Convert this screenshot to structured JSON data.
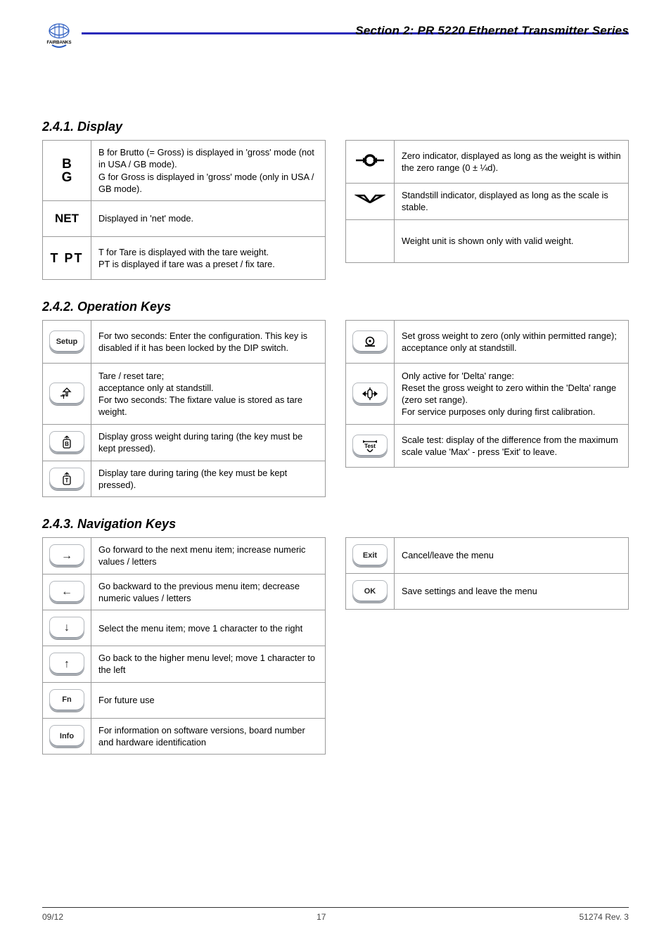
{
  "header": {
    "section_title": "Section 2: PR 5220 Ethernet Transmitter Series"
  },
  "section1": {
    "title": "2.4.1. Display",
    "left": [
      {
        "symbol": "B\nG",
        "desc": "B for Brutto (= Gross) is displayed in 'gross' mode (not in USA / GB mode).\nG for Gross is displayed in 'gross' mode (only in USA / GB mode)."
      },
      {
        "symbol": "NET",
        "desc": "Displayed in 'net' mode."
      },
      {
        "symbol": "T PT",
        "desc": "T for Tare is displayed with the tare weight.\nPT is displayed if tare was a preset / fix tare."
      }
    ],
    "right": [
      {
        "icon": "zero-range",
        "desc": "Zero indicator, displayed as long as the weight is within the zero range (0 ± ¼d)."
      },
      {
        "icon": "standstill",
        "desc": "Standstill indicator, displayed as long as the scale is stable."
      },
      {
        "icon": "unit",
        "desc": "Weight unit is shown only with valid weight."
      }
    ]
  },
  "section2": {
    "title": "2.4.2. Operation Keys",
    "left": [
      {
        "key": "Setup",
        "icon": "setup",
        "desc": "For two seconds: Enter the configuration. This key is disabled if it has been locked by the DIP switch."
      },
      {
        "key": "Tare",
        "icon": "tare",
        "desc": "Tare / reset tare;\nacceptance only at standstill.\nFor two seconds: The fixtare value is stored as tare weight."
      },
      {
        "key": "B",
        "icon": "b-key",
        "desc": "Display gross weight during taring (the key must be kept pressed)."
      },
      {
        "key": "T",
        "icon": "t-key",
        "desc": "Display tare during taring (the key must be kept pressed)."
      }
    ],
    "right": [
      {
        "key": "Zero",
        "icon": "zero-btn",
        "desc": "Set gross weight to zero (only within permitted range); acceptance only at standstill."
      },
      {
        "key": "ZeroSet",
        "icon": "zeroset-btn",
        "desc": "Only active for 'Delta' range:\nReset the gross weight to zero within the 'Delta' range (zero set range).\nFor service purposes only during first calibration."
      },
      {
        "key": "Test",
        "icon": "test-btn",
        "desc": "Scale test: display of the difference from the maximum scale value 'Max' - press 'Exit' to leave."
      }
    ]
  },
  "section3": {
    "title": "2.4.3. Navigation Keys",
    "left": [
      {
        "icon": "arrow-right",
        "desc": "Go forward to the next menu item; increase numeric values / letters"
      },
      {
        "icon": "arrow-left",
        "desc": "Go backward to the previous menu item; decrease numeric values / letters"
      },
      {
        "icon": "arrow-down",
        "desc": "Select the menu item; move 1 character to the right"
      },
      {
        "icon": "arrow-up",
        "desc": "Go back to the higher menu level; move 1 character to the left"
      },
      {
        "icon": "fn",
        "label": "Fn",
        "desc": "For future use"
      },
      {
        "icon": "info",
        "label": "Info",
        "desc": "For information on software versions, board number and hardware identification"
      }
    ],
    "right": [
      {
        "icon": "exit",
        "label": "Exit",
        "desc": "Cancel/leave the menu"
      },
      {
        "icon": "ok",
        "label": "OK",
        "desc": "Save settings and leave the menu"
      }
    ]
  },
  "footer": {
    "left": "09/12",
    "center": "17",
    "right": "51274 Rev. 3"
  }
}
